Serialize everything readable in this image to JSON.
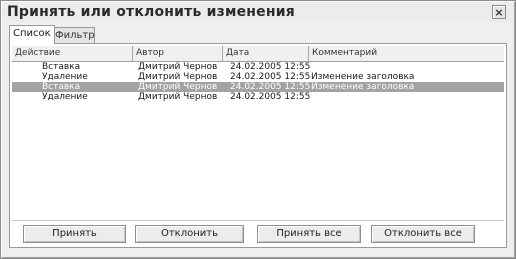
{
  "window": {
    "title": "Принять или отклонить изменения",
    "close_glyph": "×"
  },
  "tabs": [
    {
      "label": "Список",
      "active": true
    },
    {
      "label": "Фильтр",
      "active": false
    }
  ],
  "table": {
    "columns": [
      "Действие",
      "Автор",
      "Дата",
      "Комментарий"
    ],
    "rows": [
      {
        "action": "Вставка",
        "author": "Дмитрий Чернов",
        "date": "24.02.2005 12:55",
        "comment": ""
      },
      {
        "action": "Удаление",
        "author": "Дмитрий Чернов",
        "date": "24.02.2005 12:55",
        "comment": "Изменение заголовка"
      },
      {
        "action": "Вставка",
        "author": "Дмитрий Чернов",
        "date": "24.02.2005 12:55",
        "comment": "Изменение заголовка",
        "selected": true
      },
      {
        "action": "Удаление",
        "author": "Дмитрий Чернов",
        "date": "24.02.2005 12:55",
        "comment": ""
      }
    ]
  },
  "buttons": {
    "accept": "Принять",
    "reject": "Отклонить",
    "accept_all": "Принять все",
    "reject_all": "Отклонить все"
  }
}
